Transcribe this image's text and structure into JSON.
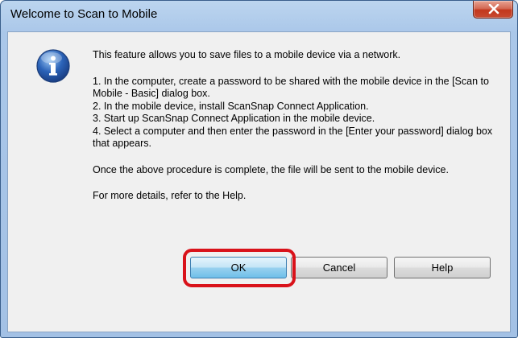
{
  "window": {
    "title": "Welcome to Scan to Mobile"
  },
  "icons": {
    "info": "info-icon",
    "close": "close-icon"
  },
  "content": {
    "intro": "This feature allows you to save files to a mobile device via a network.",
    "steps": [
      "1. In the computer, create a password to be shared with the mobile device in the [Scan to Mobile - Basic] dialog box.",
      "2. In the mobile device, install ScanSnap Connect Application.",
      "3. Start up ScanSnap Connect Application in the mobile device.",
      "4. Select a computer and then enter the password in the [Enter your password] dialog box that appears."
    ],
    "after": "Once the above procedure is complete, the file will be sent to the mobile device.",
    "more": "For more details, refer to the Help."
  },
  "buttons": {
    "ok": "OK",
    "cancel": "Cancel",
    "help": "Help"
  },
  "colors": {
    "highlight": "#d9121a",
    "close_button": "#c2371d",
    "info_icon": "#2b63b8"
  }
}
